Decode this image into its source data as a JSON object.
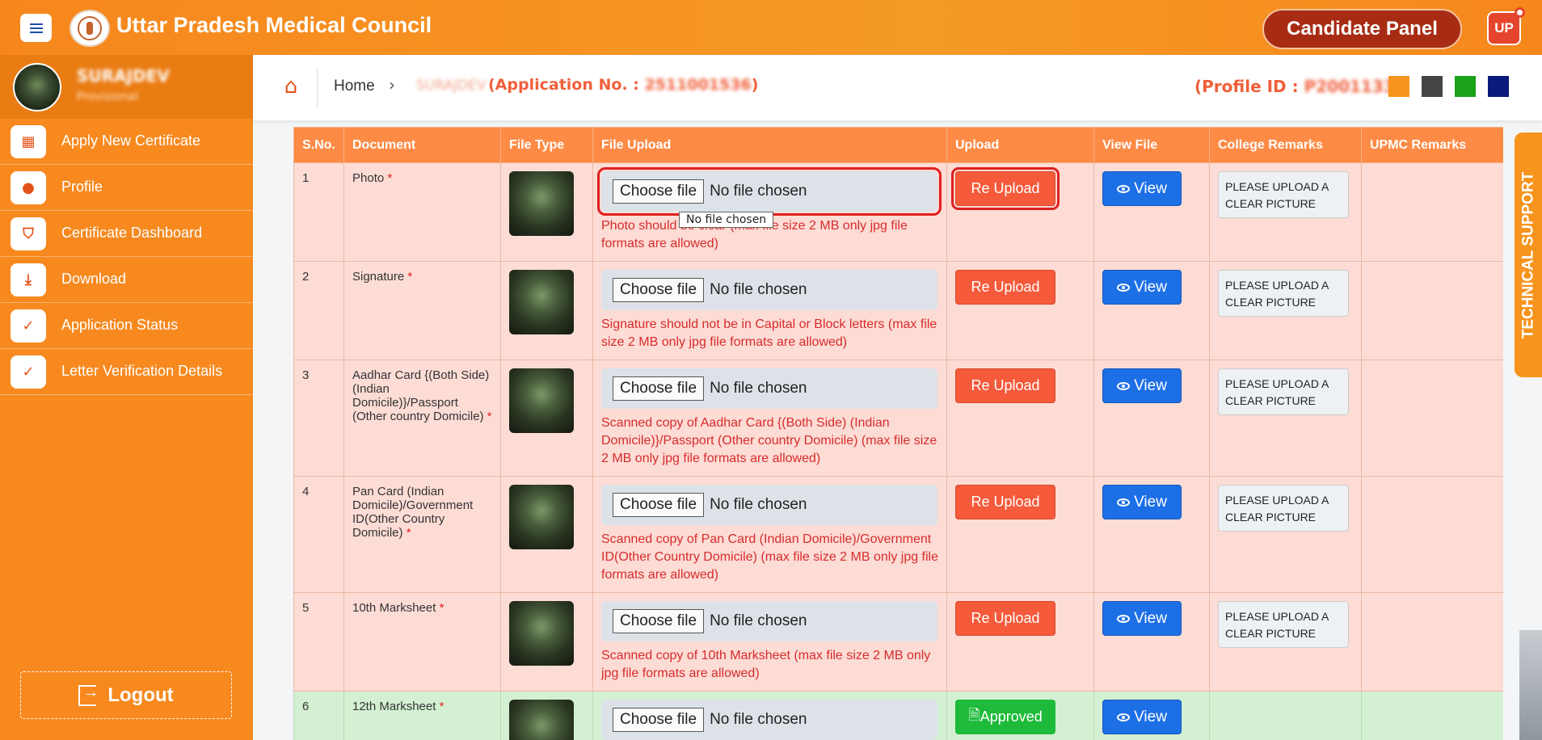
{
  "header": {
    "title": "Uttar Pradesh Medical Council",
    "panel_label": "Candidate Panel",
    "user_badge": "UP"
  },
  "sidebar": {
    "user_name": "SURAJDEV",
    "user_type": "Provisional",
    "items": [
      {
        "label": "Apply New Certificate",
        "icon": "grid-icon"
      },
      {
        "label": "Profile",
        "icon": "user-icon"
      },
      {
        "label": "Certificate Dashboard",
        "icon": "shield-icon"
      },
      {
        "label": "Download",
        "icon": "download-icon"
      },
      {
        "label": "Application Status",
        "icon": "check-badge-icon"
      },
      {
        "label": "Letter Verification Details",
        "icon": "check-badge-icon"
      }
    ],
    "logout_label": "Logout"
  },
  "breadcrumb": {
    "home": "Home",
    "name": "SURAJDEV",
    "application_prefix": "(Application No. : ",
    "application_no": "2511001536",
    "application_suffix": ")",
    "profile_prefix": "(Profile ID : ",
    "profile_id": "P2001133",
    "profile_suffix": ")"
  },
  "theme_swatches": [
    "#f7941d",
    "#444444",
    "#19a21a",
    "#0a1a7a"
  ],
  "table": {
    "headers": [
      "S.No.",
      "Document",
      "File Type",
      "File Upload",
      "Upload",
      "View File",
      "College Remarks",
      "UPMC Remarks"
    ],
    "choose_label": "Choose file",
    "no_file_label": "No file chosen",
    "tooltip": "No file chosen",
    "rows": [
      {
        "sno": "1",
        "doc": "Photo",
        "hint": "Photo should be clear (max file size 2 MB only jpg file formats are allowed)",
        "upload": "Re Upload",
        "view": "View",
        "remarks": "PLEASE UPLOAD A CLEAR PICTURE",
        "status": "pending"
      },
      {
        "sno": "2",
        "doc": "Signature",
        "hint": "Signature should not be in Capital or Block letters (max file size 2 MB only jpg file formats are allowed)",
        "upload": "Re Upload",
        "view": "View",
        "remarks": "PLEASE UPLOAD A CLEAR PICTURE",
        "status": "pending"
      },
      {
        "sno": "3",
        "doc": "Aadhar Card {(Both Side) (Indian Domicile)}/Passport (Other country Domicile)",
        "hint": "Scanned copy of Aadhar Card {(Both Side) (Indian Domicile)}/Passport (Other country Domicile) (max file size 2 MB only jpg file formats are allowed)",
        "upload": "Re Upload",
        "view": "View",
        "remarks": "PLEASE UPLOAD A CLEAR PICTURE",
        "status": "pending"
      },
      {
        "sno": "4",
        "doc": "Pan Card (Indian Domicile)/Government ID(Other Country Domicile)",
        "hint": "Scanned copy of Pan Card (Indian Domicile)/Government ID(Other Country Domicile) (max file size 2 MB only jpg file formats are allowed)",
        "upload": "Re Upload",
        "view": "View",
        "remarks": "PLEASE UPLOAD A CLEAR PICTURE",
        "status": "pending"
      },
      {
        "sno": "5",
        "doc": "10th Marksheet",
        "hint": "Scanned copy of 10th Marksheet (max file size 2 MB only jpg file formats are allowed)",
        "upload": "Re Upload",
        "view": "View",
        "remarks": "PLEASE UPLOAD A CLEAR PICTURE",
        "status": "pending"
      },
      {
        "sno": "6",
        "doc": "12th Marksheet",
        "hint": "",
        "upload": "Approved",
        "view": "View",
        "remarks": "",
        "status": "approved"
      }
    ]
  },
  "support_label": "TECHNICAL SUPPORT"
}
